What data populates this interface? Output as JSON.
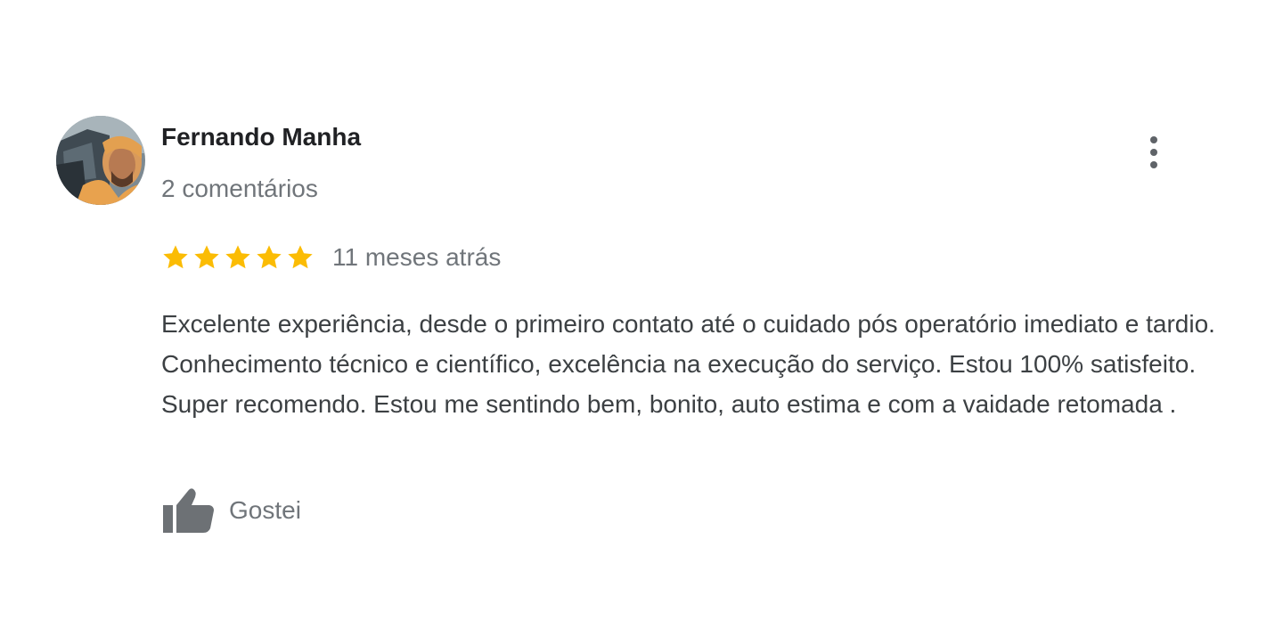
{
  "review": {
    "reviewer_name": "Fernando Manha",
    "reviewer_meta": "2 comentários",
    "rating": 5,
    "rating_max": 5,
    "time": "11 meses atrás",
    "text": "Excelente experiência, desde o primeiro contato até o cuidado pós operatório imediato e tardio. Conhecimento técnico e científico, excelência na execução do serviço. Estou 100% satisfeito. Super recomendo. Estou me sentindo bem, bonito, auto estima e com a vaidade retomada .",
    "like_label": "Gostei"
  },
  "icons": {
    "more": "more-vertical-icon",
    "star": "star-icon",
    "like": "thumbs-up-icon",
    "avatar": "avatar-photo"
  },
  "colors": {
    "star": "#fbbc04",
    "name": "#202124",
    "meta": "#70757a",
    "body_text": "#3c4043",
    "icon_gray": "#5f6368",
    "like_icon": "#6d7175"
  }
}
